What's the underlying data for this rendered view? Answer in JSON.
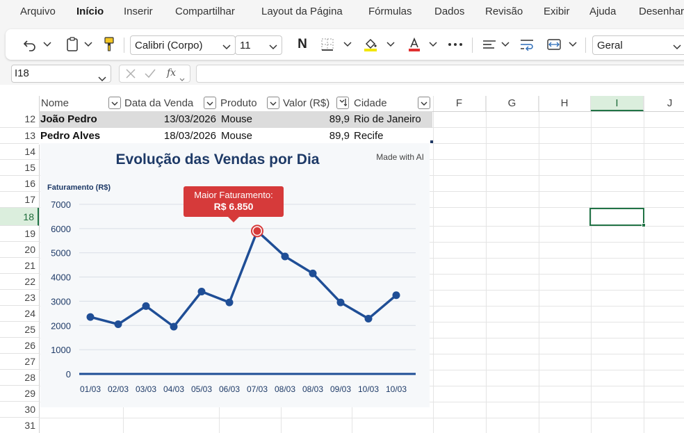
{
  "menu": {
    "items": [
      "Arquivo",
      "Início",
      "Inserir",
      "Compartilhar",
      "Layout da Página",
      "Fórmulas",
      "Dados",
      "Revisão",
      "Exibir",
      "Ajuda",
      "Desenhar"
    ]
  },
  "ribbon": {
    "font_name": "Calibri (Corpo)",
    "font_size": "11",
    "bold_label": "N",
    "number_format": "Geral",
    "font_color": "#e03030",
    "fill_color": "#f2e600"
  },
  "formula_bar": {
    "name_box": "I18",
    "fx_label": "fx",
    "formula": ""
  },
  "columns": {
    "table_headers": [
      "Nome",
      "Data da Venda",
      "Produto",
      "Valor (R$)",
      "Cidade"
    ],
    "letters": [
      "F",
      "G",
      "H",
      "I",
      "J"
    ]
  },
  "rows": {
    "numbers": [
      "12",
      "13",
      "14",
      "15",
      "16",
      "17",
      "18",
      "19",
      "20",
      "21",
      "22",
      "23",
      "24",
      "25",
      "26",
      "27",
      "28",
      "29",
      "30",
      "31"
    ],
    "data": [
      {
        "nome": "João Pedro",
        "data": "13/03/2026",
        "produto": "Mouse",
        "valor": "89,9",
        "cidade": "Rio de Janeiro"
      },
      {
        "nome": "Pedro Alves",
        "data": "18/03/2026",
        "produto": "Mouse",
        "valor": "89,9",
        "cidade": "Recife"
      }
    ]
  },
  "chart": {
    "title": "Evolução das Vendas por Dia",
    "badge": "Made with AI",
    "callout_label": "Maior Faturamento:",
    "callout_value": "R$ 6.850"
  },
  "chart_data": {
    "type": "line",
    "title": "Evolução das Vendas por Dia",
    "xlabel": "",
    "ylabel": "Faturamento (R$)",
    "ylim": [
      0,
      7000
    ],
    "yticks": [
      0,
      1000,
      2000,
      3000,
      4000,
      5000,
      6000,
      7000
    ],
    "categories": [
      "01/03",
      "02/03",
      "03/03",
      "04/03",
      "05/03",
      "06/03",
      "07/03",
      "08/03",
      "08/03",
      "09/03",
      "10/03",
      "10/03"
    ],
    "values": [
      2350,
      2050,
      2800,
      1950,
      3400,
      2950,
      5900,
      4850,
      4150,
      2950,
      2280,
      3250
    ],
    "highlight_index": 6,
    "grid": true,
    "line_color": "#1f4e96",
    "highlight_color": "#d63a3a"
  }
}
